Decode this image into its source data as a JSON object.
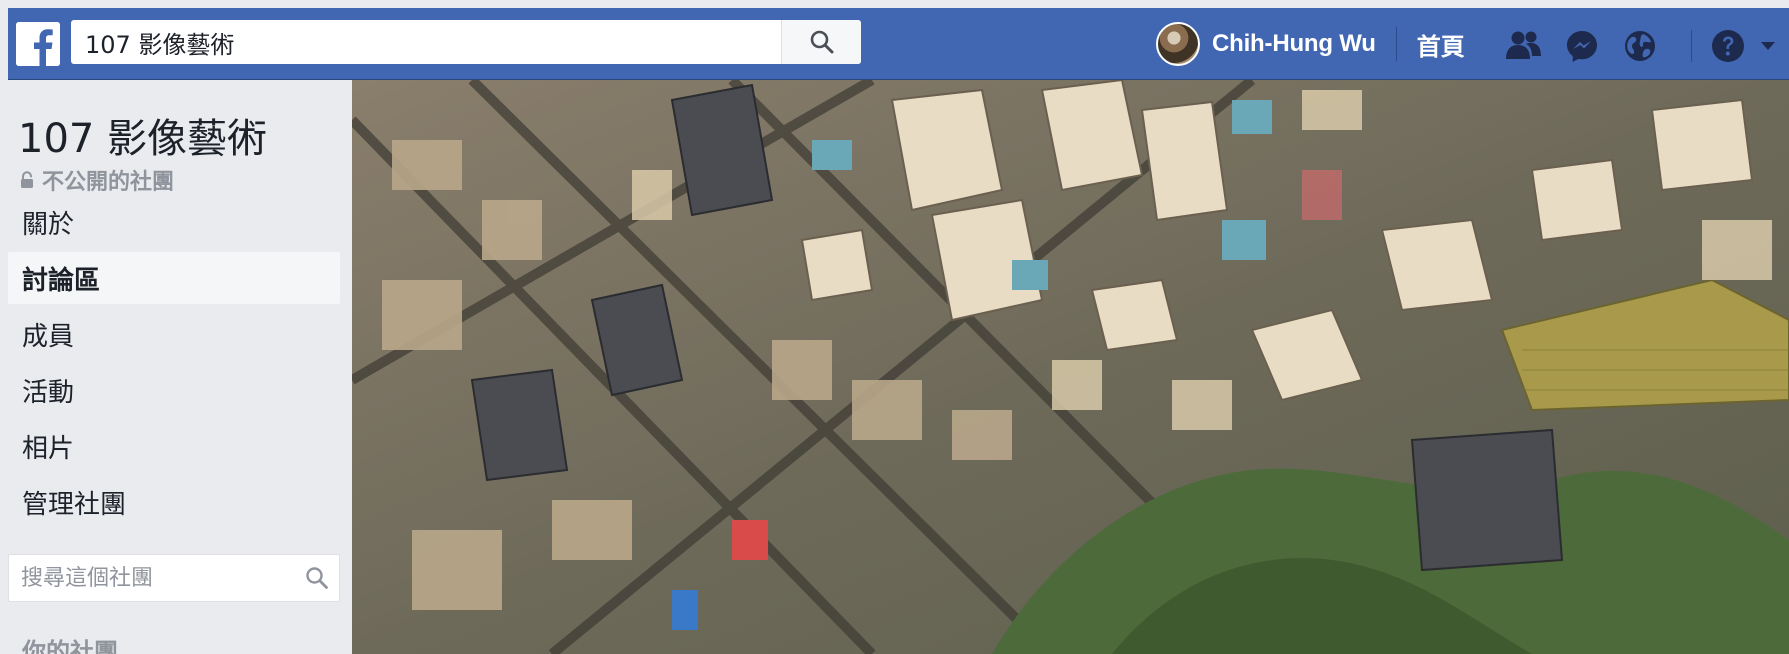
{
  "topbar": {
    "search_value": "107 影像藝術",
    "user_name": "Chih-Hung Wu",
    "home_label": "首頁",
    "brand_color": "#4267b2",
    "icons": [
      "facebook-logo-icon",
      "search-icon",
      "friends-icon",
      "messenger-icon",
      "globe-icon",
      "help-icon",
      "caret-down-icon"
    ]
  },
  "group": {
    "title": "107 影像藝術",
    "privacy": "不公開的社團"
  },
  "sidebar": {
    "items": [
      {
        "label": "關於",
        "active": false
      },
      {
        "label": "討論區",
        "active": true
      },
      {
        "label": "成員",
        "active": false
      },
      {
        "label": "活動",
        "active": false
      },
      {
        "label": "相片",
        "active": false
      },
      {
        "label": "管理社團",
        "active": false
      }
    ],
    "search_placeholder": "搜尋這個社團",
    "your_groups_label": "你的社團"
  }
}
